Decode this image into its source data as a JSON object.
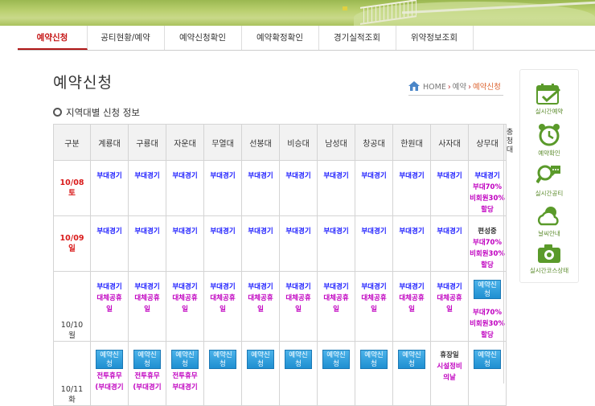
{
  "nav": {
    "items": [
      "예약신청",
      "공티현황/예약",
      "예약신청확인",
      "예약확정확인",
      "경기실적조회",
      "위약정보조회"
    ]
  },
  "page": {
    "title": "예약신청",
    "breadcrumb": {
      "home": "HOME",
      "level1": "예약",
      "level2": "예약신청"
    },
    "section_title": "지역대별 신청 정보"
  },
  "table": {
    "corner": "구분",
    "columns": [
      "계룡대",
      "구룡대",
      "자운대",
      "무열대",
      "선봉대",
      "비승대",
      "남성대",
      "창공대",
      "한원대",
      "사자대",
      "상무대"
    ],
    "extra_column": "충청대",
    "rows": [
      {
        "date": "10/08",
        "day": "토",
        "cells": [
          [
            "부대경기"
          ],
          [
            "부대경기"
          ],
          [
            "부대경기"
          ],
          [
            "부대경기"
          ],
          [
            "부대경기"
          ],
          [
            "부대경기"
          ],
          [
            "부대경기"
          ],
          [
            "부대경기"
          ],
          [
            "부대경기"
          ],
          [
            "부대경기"
          ],
          [
            "부대경기",
            "부대70%",
            "비회원30%",
            "할당"
          ]
        ]
      },
      {
        "date": "10/09",
        "day": "일",
        "cells": [
          [
            "부대경기"
          ],
          [
            "부대경기"
          ],
          [
            "부대경기"
          ],
          [
            "부대경기"
          ],
          [
            "부대경기"
          ],
          [
            "부대경기"
          ],
          [
            "부대경기"
          ],
          [
            "부대경기"
          ],
          [
            "부대경기"
          ],
          [
            "부대경기"
          ],
          [
            "편성중",
            "부대70%",
            "비회원30%",
            "할당"
          ]
        ]
      },
      {
        "date": "10/10",
        "day": "월",
        "cells": [
          [
            "부대경기",
            "대체공휴",
            "일"
          ],
          [
            "부대경기",
            "대체공휴",
            "일"
          ],
          [
            "부대경기",
            "대체공휴",
            "일"
          ],
          [
            "부대경기",
            "대체공휴",
            "일"
          ],
          [
            "부대경기",
            "대체공휴",
            "일"
          ],
          [
            "부대경기",
            "대체공휴",
            "일"
          ],
          [
            "부대경기",
            "대체공휴",
            "일"
          ],
          [
            "부대경기",
            "대체공휴",
            "일"
          ],
          [
            "부대경기",
            "대체공휴",
            "일"
          ],
          [
            "부대경기",
            "대체공휴",
            "일"
          ],
          [
            "BTN",
            "부대70%",
            "비회원30%",
            "할당"
          ]
        ]
      },
      {
        "date": "10/11",
        "day": "화",
        "cells": [
          [
            "BTN",
            "전투휴무",
            "(부대경기"
          ],
          [
            "BTN",
            "전투휴무",
            "(부대경기"
          ],
          [
            "BTN",
            "전투휴무",
            "부대경기"
          ],
          [
            "BTN"
          ],
          [
            "BTN"
          ],
          [
            "BTN"
          ],
          [
            "BTN"
          ],
          [
            "BTN"
          ],
          [
            "BTN"
          ],
          [
            "휴장일",
            "시설정비",
            "의날"
          ],
          [
            "BTN"
          ]
        ]
      }
    ],
    "button_label_1": "예약신",
    "button_label_2": "청"
  },
  "sidebar": {
    "items": [
      "실시간예약",
      "예약확인",
      "실시간공티",
      "날씨안내",
      "실시간코스상태"
    ]
  },
  "colors": {
    "accent_red": "#c51515",
    "link_blue": "#1a1aff",
    "magenta": "#c000c0",
    "button_blue": "#1f8fd1",
    "sidebar_green": "#5a9a2a"
  }
}
